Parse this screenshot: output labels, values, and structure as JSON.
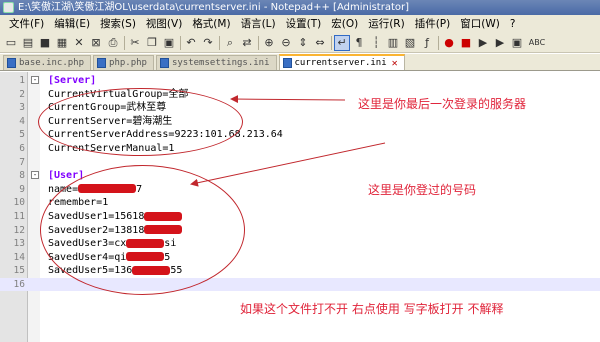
{
  "window": {
    "title": "E:\\笑傲江湖\\笑傲江湖OL\\userdata\\currentserver.ini - Notepad++ [Administrator]"
  },
  "menu": [
    "文件(F)",
    "编辑(E)",
    "搜索(S)",
    "视图(V)",
    "格式(M)",
    "语言(L)",
    "设置(T)",
    "宏(O)",
    "运行(R)",
    "插件(P)",
    "窗口(W)",
    "?"
  ],
  "toolbar": {
    "icons": [
      "new-file-icon",
      "open-icon",
      "save-icon",
      "save-all-icon",
      "close-icon",
      "close-all-icon",
      "print-icon",
      "cut-icon",
      "copy-icon",
      "paste-icon",
      "undo-icon",
      "redo-icon",
      "find-icon",
      "replace-icon",
      "zoom-in-icon",
      "zoom-out-icon",
      "sync-v-icon",
      "sync-h-icon",
      "wrap-icon",
      "all-chars-icon",
      "indent-guide-icon",
      "udl-icon",
      "doc-map-icon",
      "function-list-icon",
      "record-macro-icon",
      "stop-macro-icon",
      "play-macro-icon",
      "run-macro-multiple-icon",
      "save-macro-icon",
      "spellcheck-icon"
    ],
    "spellcheck_label": "ABC"
  },
  "tabs": [
    {
      "label": "base.inc.php",
      "active": false
    },
    {
      "label": "php.php",
      "active": false
    },
    {
      "label": "systemsettings.ini",
      "active": false
    },
    {
      "label": "currentserver.ini",
      "active": true
    }
  ],
  "lines": [
    {
      "n": "1",
      "text": "[Server]",
      "type": "section"
    },
    {
      "n": "2",
      "key": "CurrentVirtualGroup",
      "val": "全部"
    },
    {
      "n": "3",
      "key": "CurrentGroup",
      "val": "武林至尊"
    },
    {
      "n": "4",
      "key": "CurrentServer",
      "val": "碧海潮生"
    },
    {
      "n": "5",
      "key": "CurrentServerAddress",
      "val": "9223:101.68.213.64"
    },
    {
      "n": "6",
      "key": "CurrentServerManual",
      "val": "1"
    },
    {
      "n": "7",
      "text": "",
      "type": "blank"
    },
    {
      "n": "8",
      "text": "[User]",
      "type": "section"
    },
    {
      "n": "9",
      "key": "name",
      "val": "7",
      "redacted": true
    },
    {
      "n": "10",
      "key": "remember",
      "val": "1"
    },
    {
      "n": "11",
      "key": "SavedUser1",
      "val": "15618",
      "redacted": true
    },
    {
      "n": "12",
      "key": "SavedUser2",
      "val": "13818",
      "redacted": true
    },
    {
      "n": "13",
      "key": "SavedUser3",
      "val": "cx",
      "suffix": "si",
      "redacted": true
    },
    {
      "n": "14",
      "key": "SavedUser4",
      "val": "qi",
      "suffix": "5",
      "redacted": true
    },
    {
      "n": "15",
      "key": "SavedUser5",
      "val": "136",
      "suffix": "55",
      "redacted": true
    },
    {
      "n": "16",
      "text": "",
      "type": "blank"
    }
  ],
  "annotations": {
    "server_note": "这里是你最后一次登录的服务器",
    "user_note": "这里是你登过的号码",
    "footer_note": "如果这个文件打不开  右点使用  写字板打开    不解释"
  },
  "colors": {
    "section": "#8000ff",
    "annotation": "#e0243a",
    "redaction": "#d4131a"
  }
}
